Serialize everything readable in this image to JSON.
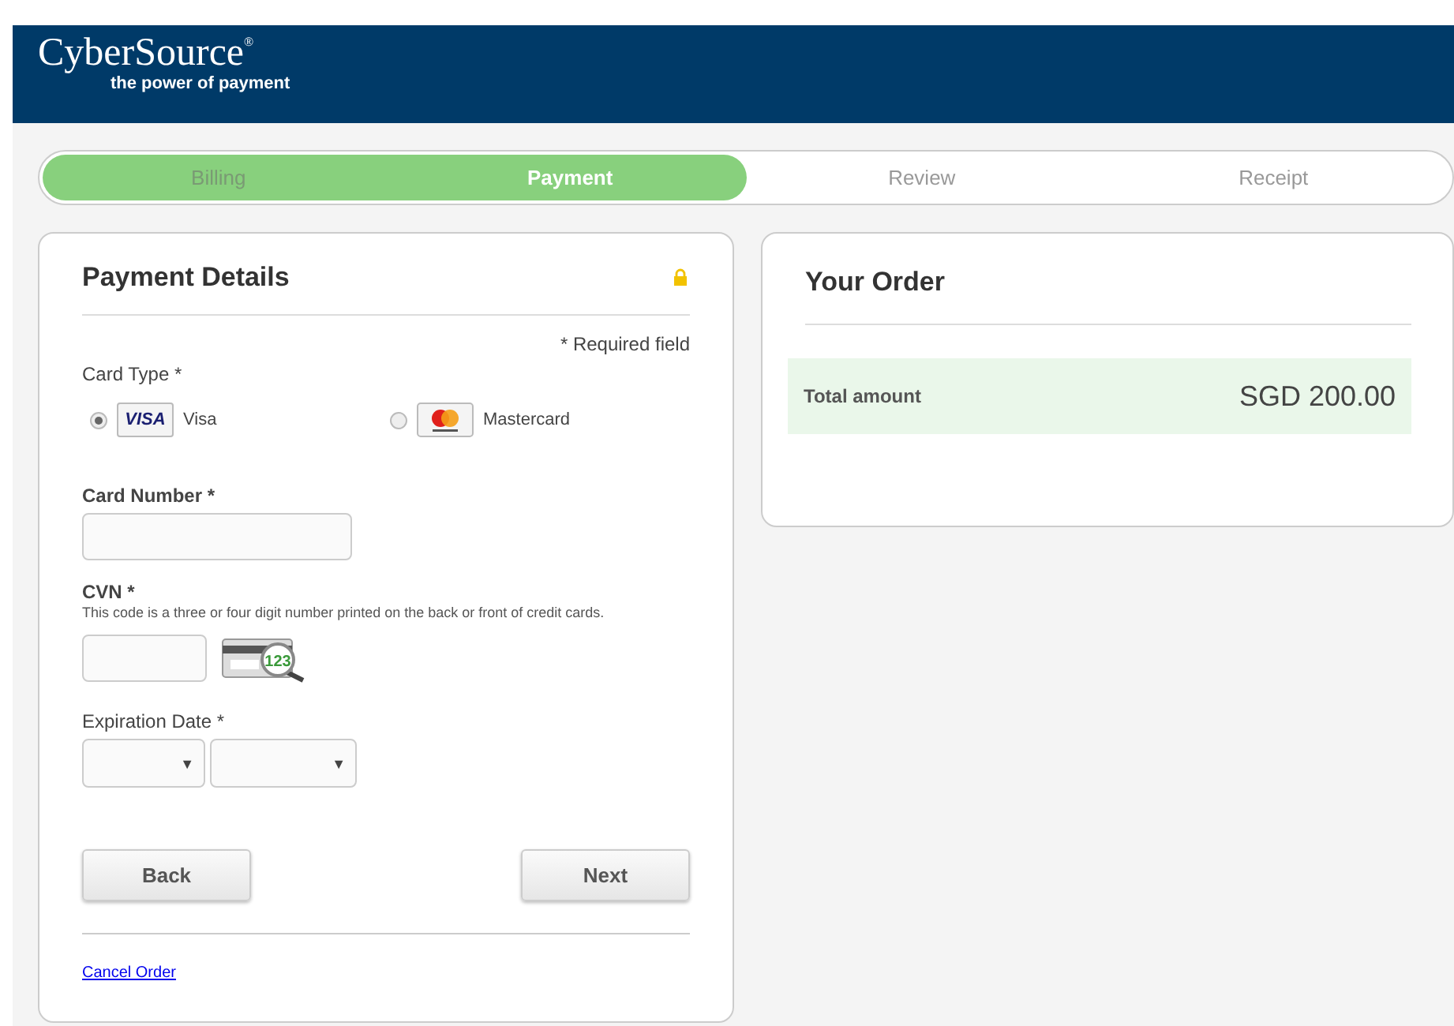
{
  "header": {
    "logo": "CyberSource",
    "logo_mark": "®",
    "tagline": "the power of payment"
  },
  "steps": [
    {
      "label": "Billing",
      "completed": true,
      "selected": false
    },
    {
      "label": "Payment",
      "completed": true,
      "selected": true
    },
    {
      "label": "Review",
      "completed": false,
      "selected": false
    },
    {
      "label": "Receipt",
      "completed": false,
      "selected": false
    }
  ],
  "payment": {
    "title": "Payment Details",
    "required_note": "* Required field",
    "card_type": {
      "label": "Card Type *",
      "options": [
        {
          "kind": "visa",
          "logo_text": "VISA",
          "label": "Visa",
          "selected": true
        },
        {
          "kind": "mastercard",
          "label": "Mastercard",
          "selected": false
        }
      ]
    },
    "card_number": {
      "label": "Card Number *"
    },
    "cvn": {
      "label": "CVN *",
      "hint": "This code is a three or four digit number printed on the back or front of credit cards.",
      "icon_text": "123"
    },
    "expiration": {
      "label": "Expiration Date *",
      "selects": [
        "▼",
        "▼"
      ]
    },
    "buttons": [
      "Back",
      "Next"
    ],
    "cancel_link": "Cancel Order"
  },
  "order": {
    "title": "Your Order",
    "total_label": "Total amount",
    "total_value": "SGD 200.00"
  }
}
